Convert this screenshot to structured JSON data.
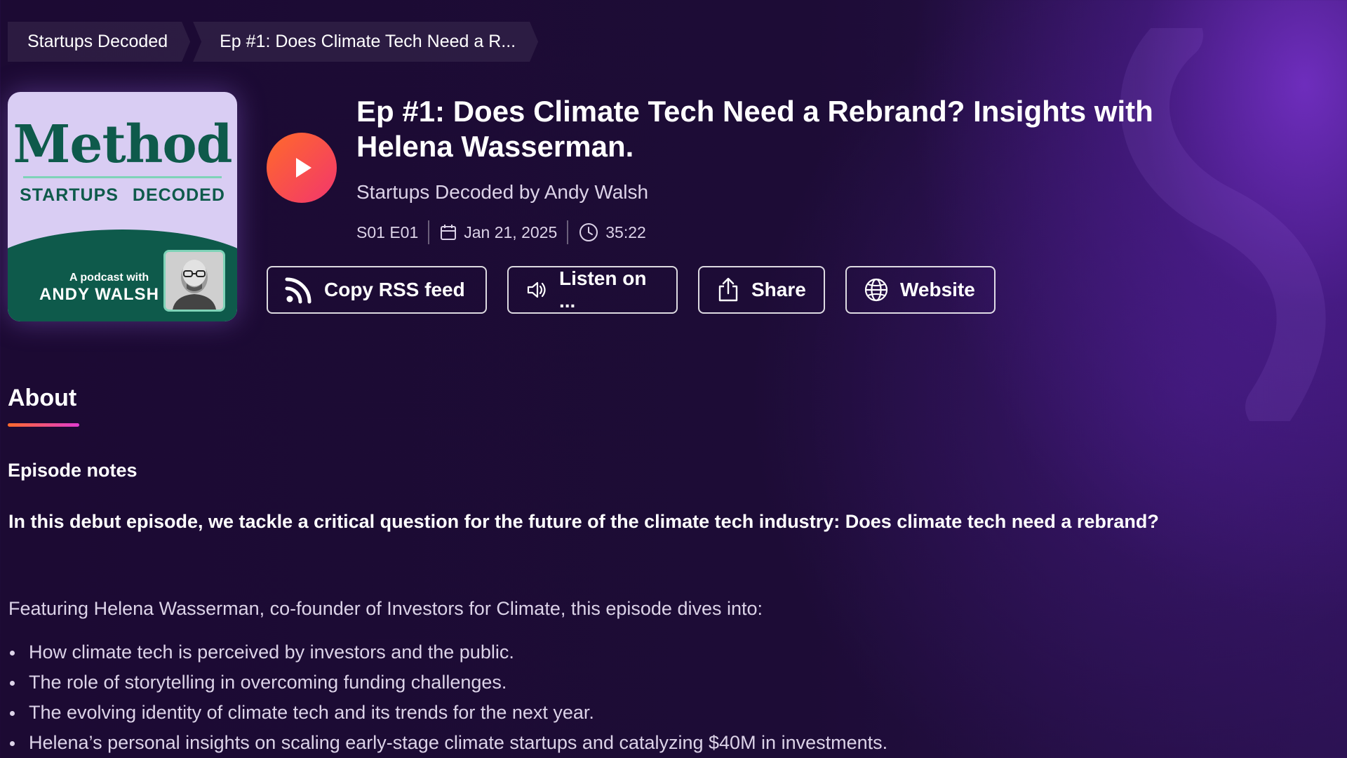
{
  "breadcrumb": {
    "items": [
      "Startups Decoded",
      "Ep #1: Does Climate Tech Need a R..."
    ]
  },
  "cover": {
    "brand": "Method",
    "subtitle": "STARTUPS DECODED",
    "tagline": "A podcast with",
    "host": "ANDY WALSH"
  },
  "episode": {
    "title": "Ep #1: Does Climate Tech Need a Rebrand? Insights with Helena Wasserman.",
    "author": "Startups Decoded by Andy Walsh",
    "season_episode": "S01 E01",
    "date": "Jan 21, 2025",
    "duration": "35:22"
  },
  "actions": {
    "rss": "Copy RSS feed",
    "listen": "Listen on ...",
    "share": "Share",
    "website": "Website"
  },
  "about": {
    "heading": "About",
    "notes_heading": "Episode notes",
    "intro": "In this debut episode, we tackle a critical question for the future of the climate tech industry: Does climate tech need a rebrand?",
    "featuring": "Featuring Helena Wasserman, co-founder of Investors for Climate, this episode dives into:",
    "bullets": [
      "How climate tech is perceived by investors and the public.",
      "The role of storytelling in overcoming funding challenges.",
      "The evolving identity of climate tech and its trends for the next year.",
      "Helena’s personal insights on scaling early-stage climate startups and catalyzing $40M in investments."
    ]
  },
  "colors": {
    "background": "#1d0c36",
    "accent_orange": "#ff6a2a",
    "accent_pink": "#f2366d",
    "cover_green": "#0e5a4b",
    "cover_lilac": "#d9cdf3"
  },
  "icons": {
    "play": "play-icon",
    "calendar": "calendar-icon",
    "clock": "clock-icon",
    "rss": "rss-icon",
    "speaker": "speaker-icon",
    "share": "share-icon",
    "globe": "globe-icon"
  }
}
